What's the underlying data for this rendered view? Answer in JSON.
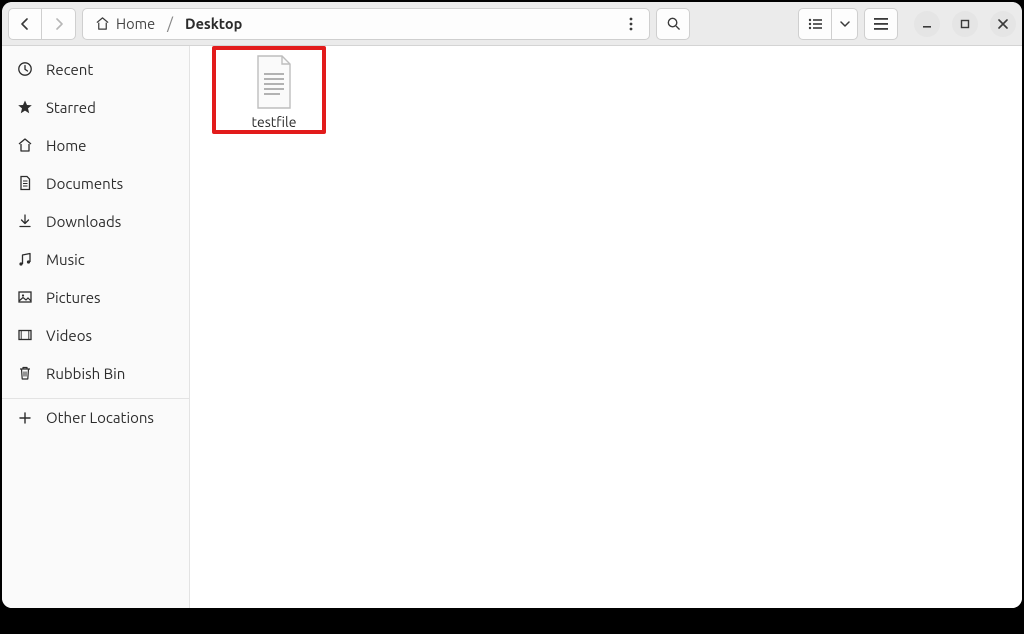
{
  "breadcrumb": {
    "home_label": "Home",
    "current_label": "Desktop"
  },
  "sidebar": {
    "items": [
      {
        "icon": "recent-icon",
        "label": "Recent"
      },
      {
        "icon": "star-icon",
        "label": "Starred"
      },
      {
        "icon": "home-icon",
        "label": "Home"
      },
      {
        "icon": "documents-icon",
        "label": "Documents"
      },
      {
        "icon": "downloads-icon",
        "label": "Downloads"
      },
      {
        "icon": "music-icon",
        "label": "Music"
      },
      {
        "icon": "pictures-icon",
        "label": "Pictures"
      },
      {
        "icon": "videos-icon",
        "label": "Videos"
      },
      {
        "icon": "trash-icon",
        "label": "Rubbish Bin"
      }
    ],
    "other_label": "Other Locations"
  },
  "files": [
    {
      "name": "testfile",
      "kind": "text-document",
      "highlighted": true
    }
  ],
  "colors": {
    "highlight_border": "#e21b1b",
    "headerbar_bg": "#ebebeb",
    "sidebar_bg": "#fafafa"
  }
}
